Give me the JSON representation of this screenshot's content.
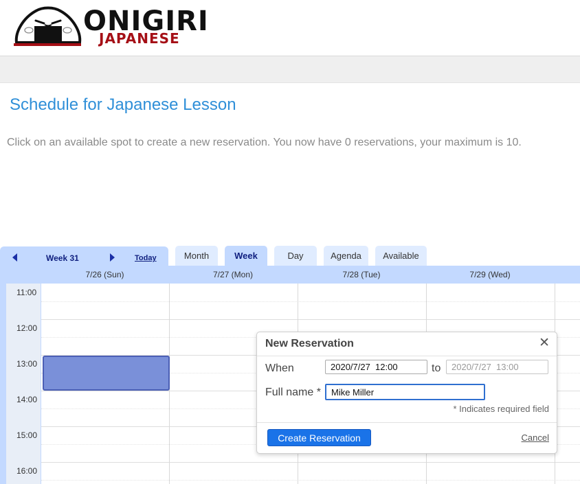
{
  "brand": {
    "name": "ONIGIRI",
    "subtitle": "JAPANESE"
  },
  "page": {
    "title": "Schedule for Japanese Lesson",
    "instructions": "Click on an available spot to create a new reservation. You now have 0 reservations, your maximum is 10."
  },
  "calendar": {
    "week_label": "Week 31",
    "today_label": "Today",
    "tabs": [
      "Month",
      "Week",
      "Day",
      "Agenda",
      "Available"
    ],
    "active_tab": "Week",
    "days": [
      "7/26 (Sun)",
      "7/27 (Mon)",
      "7/28 (Tue)",
      "7/29 (Wed)"
    ],
    "times": [
      "11:00",
      "12:00",
      "13:00",
      "14:00",
      "15:00",
      "16:00"
    ]
  },
  "popup": {
    "title": "New Reservation",
    "close_symbol": "✕",
    "when_label": "When",
    "from_value": "2020/7/27  12:00",
    "to_label": "to",
    "to_value": "2020/7/27  13:00",
    "name_label": "Full name *",
    "name_value": "Mike Miller",
    "required_note": "* Indicates required field",
    "create_label": "Create Reservation",
    "cancel_label": "Cancel"
  },
  "colors": {
    "accent_title": "#2f8fd8",
    "brand_red": "#a50f16",
    "calendar_blue": "#c3d9ff",
    "selected_slot": "#7a90d9",
    "button_blue": "#1a73e8"
  }
}
